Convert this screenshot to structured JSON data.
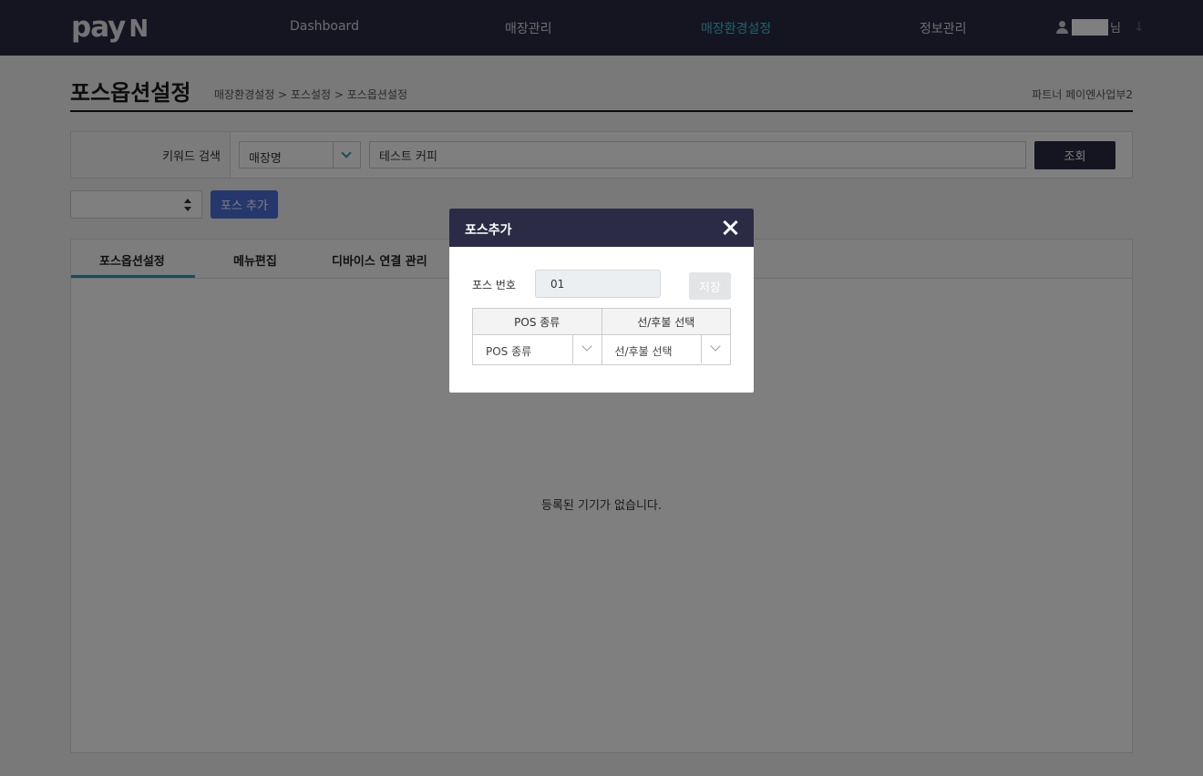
{
  "brand": {
    "logo_text": "pay",
    "logo_mark": "N"
  },
  "nav": {
    "items": [
      {
        "label": "Dashboard"
      },
      {
        "label": "매장관리"
      },
      {
        "label": "매장환경설정"
      },
      {
        "label": "정보관리"
      }
    ],
    "active_index": 2,
    "user_suffix": "님"
  },
  "page": {
    "title": "포스옵션설정",
    "breadcrumb": "매장환경설정 > 포스설정 > 포스옵션설정",
    "partner": "파트너 페이엔사업부2"
  },
  "search": {
    "label": "키워드 검색",
    "type_value": "매장명",
    "keyword_value": "테스트 커피",
    "button_label": "조회"
  },
  "controls": {
    "add_pos_label": "포스 추가"
  },
  "tabs": [
    {
      "label": "포스옵션설정",
      "active": true
    },
    {
      "label": "메뉴편집",
      "active": false
    },
    {
      "label": "디바이스 연결 관리",
      "active": false
    }
  ],
  "empty_message": "등록된 기기가 없습니다.",
  "modal": {
    "title": "포스추가",
    "pos_number_label": "포스 번호",
    "pos_number_value": "01",
    "save_label": "저장",
    "table_headers": [
      "POS 종류",
      "선/후불 선택"
    ],
    "pos_type_selected": "POS 종류",
    "payment_type_selected": "선/후불 선택"
  },
  "colors": {
    "navbar": "#2b2b45",
    "accent": "#3fc3d6",
    "primary_button": "#4a6ed8"
  }
}
